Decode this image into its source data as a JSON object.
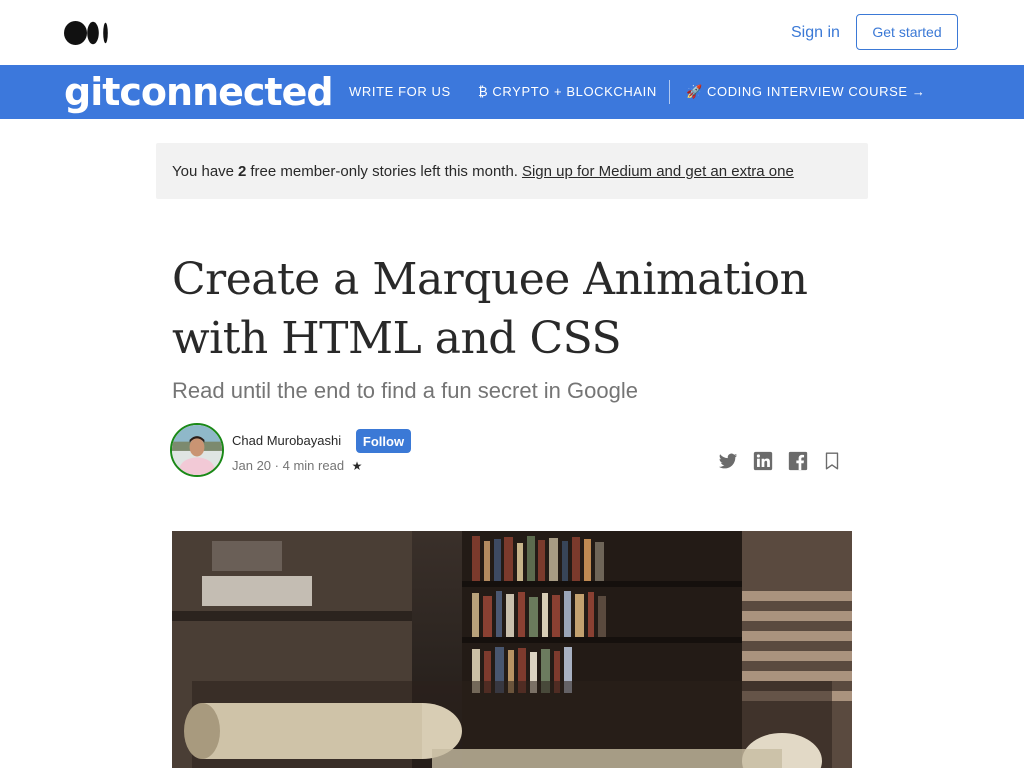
{
  "header": {
    "logo_icon": "medium-logo-icon",
    "sign_in": "Sign in",
    "get_started": "Get started"
  },
  "publication": {
    "name": "gitconnected",
    "nav": [
      {
        "label": "WRITE FOR US"
      },
      {
        "label": "₿ CRYPTO + BLOCKCHAIN"
      },
      {
        "label": "🚀 CODING INTERVIEW COURSE →"
      }
    ],
    "bar_color": "#3c78dc"
  },
  "banner": {
    "prefix": "You have",
    "count": "2",
    "suffix": "free member-only stories left this month.",
    "link": "Sign up for Medium and get an extra one"
  },
  "article": {
    "title": "Create a Marquee Animation with HTML and CSS",
    "subtitle": "Read until the end to find a fun secret in Google",
    "author": "Chad Murobayashi",
    "follow": "Follow",
    "date": "Jan 20",
    "read_time": "4 min read",
    "member_star": "★",
    "share_icons": [
      "twitter-icon",
      "linkedin-icon",
      "facebook-icon",
      "bookmark-icon"
    ]
  },
  "colors": {
    "accent": "#3b79d6",
    "author_ring": "#1a8917"
  }
}
